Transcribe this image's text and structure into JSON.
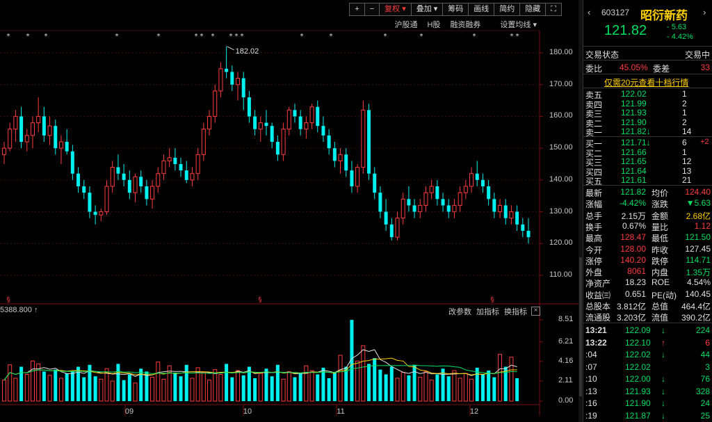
{
  "toolbar": {
    "plus": "+",
    "minus": "−",
    "fuquan": "复权",
    "diejia": "叠加",
    "chouma": "筹码",
    "huaxian": "画线",
    "jianyue": "简约",
    "yincang": "隐藏",
    "fullscreen": "⛶"
  },
  "subbar": {
    "hugutong": "沪股通",
    "hgu": "H股",
    "rongzi": "融资融券",
    "junxian": "设置均线"
  },
  "volume_tools": {
    "base": "5388.800",
    "gaicanshu": "改参数",
    "jiazhibiao": "加指标",
    "huanzhibiao": "换指标"
  },
  "chart_data": {
    "type": "candlestick",
    "price_axis": [
      180,
      170,
      160,
      150,
      140,
      130,
      120,
      110
    ],
    "price_axis_labels": [
      "180.00",
      "170.00",
      "160.00",
      "150.00",
      "140.00",
      "130.00",
      "120.00",
      "110.00"
    ],
    "volume_axis_labels": [
      "8.51",
      "6.21",
      "4.16",
      "2.11",
      "0.00"
    ],
    "month_labels": [
      "09",
      "10",
      "11",
      "12"
    ],
    "max_marker": "182.02",
    "ohlc": [
      [
        148,
        152,
        145,
        150
      ],
      [
        150,
        158,
        149,
        156
      ],
      [
        156,
        162,
        152,
        160
      ],
      [
        160,
        163,
        150,
        152
      ],
      [
        152,
        156,
        149,
        154
      ],
      [
        154,
        160,
        150,
        158
      ],
      [
        158,
        166,
        155,
        160
      ],
      [
        160,
        163,
        152,
        154
      ],
      [
        154,
        160,
        151,
        157
      ],
      [
        157,
        159,
        148,
        150
      ],
      [
        150,
        154,
        145,
        152
      ],
      [
        152,
        156,
        148,
        149
      ],
      [
        149,
        151,
        140,
        142
      ],
      [
        142,
        144,
        136,
        138
      ],
      [
        138,
        140,
        134,
        136
      ],
      [
        136,
        138,
        128,
        130
      ],
      [
        130,
        132,
        126,
        129
      ],
      [
        129,
        131,
        127,
        130
      ],
      [
        130,
        140,
        129,
        138
      ],
      [
        138,
        146,
        136,
        144
      ],
      [
        144,
        148,
        140,
        142
      ],
      [
        142,
        145,
        138,
        140
      ],
      [
        140,
        143,
        134,
        136
      ],
      [
        136,
        142,
        133,
        141
      ],
      [
        141,
        143,
        136,
        138
      ],
      [
        138,
        140,
        132,
        134
      ],
      [
        134,
        140,
        131,
        138
      ],
      [
        138,
        144,
        136,
        142
      ],
      [
        142,
        148,
        140,
        146
      ],
      [
        146,
        150,
        144,
        147
      ],
      [
        147,
        150,
        143,
        145
      ],
      [
        145,
        147,
        141,
        143
      ],
      [
        143,
        146,
        139,
        140
      ],
      [
        140,
        144,
        138,
        142
      ],
      [
        142,
        150,
        140,
        148
      ],
      [
        148,
        158,
        146,
        156
      ],
      [
        156,
        162,
        154,
        160
      ],
      [
        160,
        170,
        158,
        168
      ],
      [
        168,
        177,
        166,
        175
      ],
      [
        175,
        182,
        172,
        174
      ],
      [
        174,
        176,
        168,
        170
      ],
      [
        170,
        174,
        165,
        172
      ],
      [
        172,
        174,
        162,
        166
      ],
      [
        166,
        168,
        158,
        160
      ],
      [
        160,
        162,
        154,
        156
      ],
      [
        156,
        160,
        152,
        158
      ],
      [
        158,
        162,
        154,
        157
      ],
      [
        157,
        158,
        150,
        152
      ],
      [
        152,
        154,
        146,
        148
      ],
      [
        148,
        158,
        146,
        156
      ],
      [
        156,
        163,
        154,
        162
      ],
      [
        162,
        164,
        158,
        160
      ],
      [
        160,
        162,
        154,
        156
      ],
      [
        156,
        160,
        153,
        158
      ],
      [
        158,
        164,
        156,
        163
      ],
      [
        163,
        165,
        155,
        157
      ],
      [
        157,
        160,
        152,
        154
      ],
      [
        154,
        156,
        148,
        150
      ],
      [
        150,
        152,
        144,
        146
      ],
      [
        146,
        150,
        142,
        148
      ],
      [
        148,
        150,
        141,
        143
      ],
      [
        143,
        146,
        136,
        138
      ],
      [
        138,
        145,
        136,
        144
      ],
      [
        144,
        165,
        142,
        162
      ],
      [
        162,
        164,
        140,
        142
      ],
      [
        142,
        144,
        134,
        136
      ],
      [
        136,
        138,
        128,
        130
      ],
      [
        130,
        134,
        124,
        126
      ],
      [
        126,
        128,
        121,
        122
      ],
      [
        122,
        130,
        121,
        128
      ],
      [
        128,
        136,
        126,
        134
      ],
      [
        134,
        138,
        130,
        132
      ],
      [
        132,
        134,
        128,
        130
      ],
      [
        130,
        134,
        128,
        132
      ],
      [
        132,
        138,
        130,
        136
      ],
      [
        136,
        140,
        134,
        138
      ],
      [
        138,
        140,
        132,
        134
      ],
      [
        134,
        136,
        130,
        132
      ],
      [
        132,
        134,
        128,
        130
      ],
      [
        130,
        134,
        128,
        132
      ],
      [
        132,
        138,
        130,
        136
      ],
      [
        136,
        140,
        134,
        138
      ],
      [
        138,
        144,
        136,
        142
      ],
      [
        142,
        146,
        138,
        140
      ],
      [
        140,
        142,
        136,
        138
      ],
      [
        138,
        140,
        132,
        134
      ],
      [
        134,
        136,
        128,
        130
      ],
      [
        130,
        134,
        128,
        132
      ],
      [
        132,
        134,
        126,
        128
      ],
      [
        128,
        132,
        126,
        130
      ],
      [
        130,
        132,
        124,
        126
      ],
      [
        126,
        128,
        122,
        124
      ],
      [
        124,
        128,
        120,
        122
      ]
    ],
    "volume": [
      2.2,
      3.8,
      2.4,
      3.6,
      2.8,
      4.2,
      3.9,
      3.1,
      2.7,
      3.3,
      2.4,
      2.9,
      3.1,
      3.6,
      2.5,
      3.8,
      2.6,
      2.3,
      3.4,
      2.1,
      3.9,
      2.2,
      2.8,
      1.9,
      3.4,
      3.1,
      2.5,
      4.1,
      2.3,
      3.7,
      2.9,
      2.6,
      3.8,
      2.4,
      3.5,
      3.0,
      2.2,
      3.3,
      2.8,
      3.9,
      2.5,
      3.2,
      2.7,
      3.6,
      2.4,
      2.9,
      3.4,
      2.6,
      3.8,
      2.3,
      3.1,
      2.5,
      2.9,
      3.7,
      3.2,
      2.8,
      3.5,
      2.4,
      3.0,
      4.8,
      3.6,
      8.5,
      4.2,
      5.8,
      3.9,
      4.5,
      3.3,
      2.8,
      3.6,
      2.4,
      3.0,
      2.7,
      3.8,
      2.5,
      3.1,
      2.2,
      2.8,
      3.4,
      2.6,
      3.2,
      2.4,
      2.9,
      2.3,
      3.5,
      2.8,
      3.2,
      2.5,
      4.9,
      3.6,
      4.6,
      2.4
    ]
  },
  "panel": {
    "code": "603127",
    "name": "昭衍新药",
    "price": "121.82",
    "change": "- 5.63",
    "change_pct": "- 4.42%",
    "status_label": "交易状态",
    "status_value": "交易中",
    "weibi_label": "委比",
    "weibi_value": "45.05%",
    "weicha_label": "委差",
    "weicha_value": "33",
    "promo": "仅需20元查看十档行情",
    "asks": [
      {
        "label": "卖五",
        "price": "122.02",
        "vol": "1"
      },
      {
        "label": "卖四",
        "price": "121.99",
        "vol": "2"
      },
      {
        "label": "卖三",
        "price": "121.93",
        "vol": "1"
      },
      {
        "label": "卖二",
        "price": "121.90",
        "vol": "2"
      },
      {
        "label": "卖一",
        "price": "121.82↓",
        "vol": "14"
      }
    ],
    "bids": [
      {
        "label": "买一",
        "price": "121.71↓",
        "vol": "6",
        "extra": "+2"
      },
      {
        "label": "买二",
        "price": "121.66",
        "vol": "1",
        "extra": ""
      },
      {
        "label": "买三",
        "price": "121.65",
        "vol": "12",
        "extra": ""
      },
      {
        "label": "买四",
        "price": "121.64",
        "vol": "13",
        "extra": ""
      },
      {
        "label": "买五",
        "price": "121.61",
        "vol": "21",
        "extra": ""
      }
    ],
    "stats": [
      {
        "l1": "最新",
        "v1": "121.82",
        "c1": "green",
        "l2": "均价",
        "v2": "124.40",
        "c2": "red"
      },
      {
        "l1": "涨幅",
        "v1": "-4.42%",
        "c1": "green",
        "l2": "涨跌",
        "v2": "▼5.63",
        "c2": "green"
      },
      {
        "l1": "总手",
        "v1": "2.15万",
        "c1": "white",
        "l2": "金额",
        "v2": "2.68亿",
        "c2": "yellow"
      },
      {
        "l1": "换手",
        "v1": "0.67%",
        "c1": "white",
        "l2": "量比",
        "v2": "1.12",
        "c2": "red"
      },
      {
        "l1": "最高",
        "v1": "128.47",
        "c1": "red",
        "l2": "最低",
        "v2": "121.50",
        "c2": "green"
      },
      {
        "l1": "今开",
        "v1": "128.00",
        "c1": "red",
        "l2": "昨收",
        "v2": "127.45",
        "c2": "white"
      },
      {
        "l1": "涨停",
        "v1": "140.20",
        "c1": "red",
        "l2": "跌停",
        "v2": "114.71",
        "c2": "green"
      },
      {
        "l1": "外盘",
        "v1": "8061",
        "c1": "red",
        "l2": "内盘",
        "v2": "1.35万",
        "c2": "green"
      },
      {
        "l1": "净资产",
        "v1": "18.23",
        "c1": "white",
        "l2": "ROE",
        "v2": "4.54%",
        "c2": "white"
      },
      {
        "l1": "收益㈢",
        "v1": "0.651",
        "c1": "white",
        "l2": "PE(动)",
        "v2": "140.45",
        "c2": "white"
      },
      {
        "l1": "总股本",
        "v1": "3.812亿",
        "c1": "white",
        "l2": "总值",
        "v2": "464.4亿",
        "c2": "white"
      },
      {
        "l1": "流通股",
        "v1": "3.203亿",
        "c1": "white",
        "l2": "流值",
        "v2": "390.2亿",
        "c2": "white"
      }
    ],
    "ticks": [
      {
        "t": "13:21",
        "p": "122.09",
        "arrow": "↓",
        "ac": "green",
        "v": "224",
        "vc": "green"
      },
      {
        "t": "13:22",
        "p": "122.10",
        "arrow": "↑",
        "ac": "red",
        "v": "6",
        "vc": "red"
      },
      {
        "t": ":04",
        "p": "122.02",
        "arrow": "↓",
        "ac": "green",
        "v": "44",
        "vc": "green"
      },
      {
        "t": ":07",
        "p": "122.02",
        "arrow": "",
        "ac": "green",
        "v": "3",
        "vc": "green"
      },
      {
        "t": ":10",
        "p": "122.00",
        "arrow": "↓",
        "ac": "green",
        "v": "76",
        "vc": "green"
      },
      {
        "t": ":13",
        "p": "121.93",
        "arrow": "↓",
        "ac": "green",
        "v": "328",
        "vc": "green"
      },
      {
        "t": ":16",
        "p": "121.90",
        "arrow": "↓",
        "ac": "green",
        "v": "24",
        "vc": "green"
      },
      {
        "t": ":19",
        "p": "121.87",
        "arrow": "↓",
        "ac": "green",
        "v": "25",
        "vc": "green"
      }
    ]
  }
}
